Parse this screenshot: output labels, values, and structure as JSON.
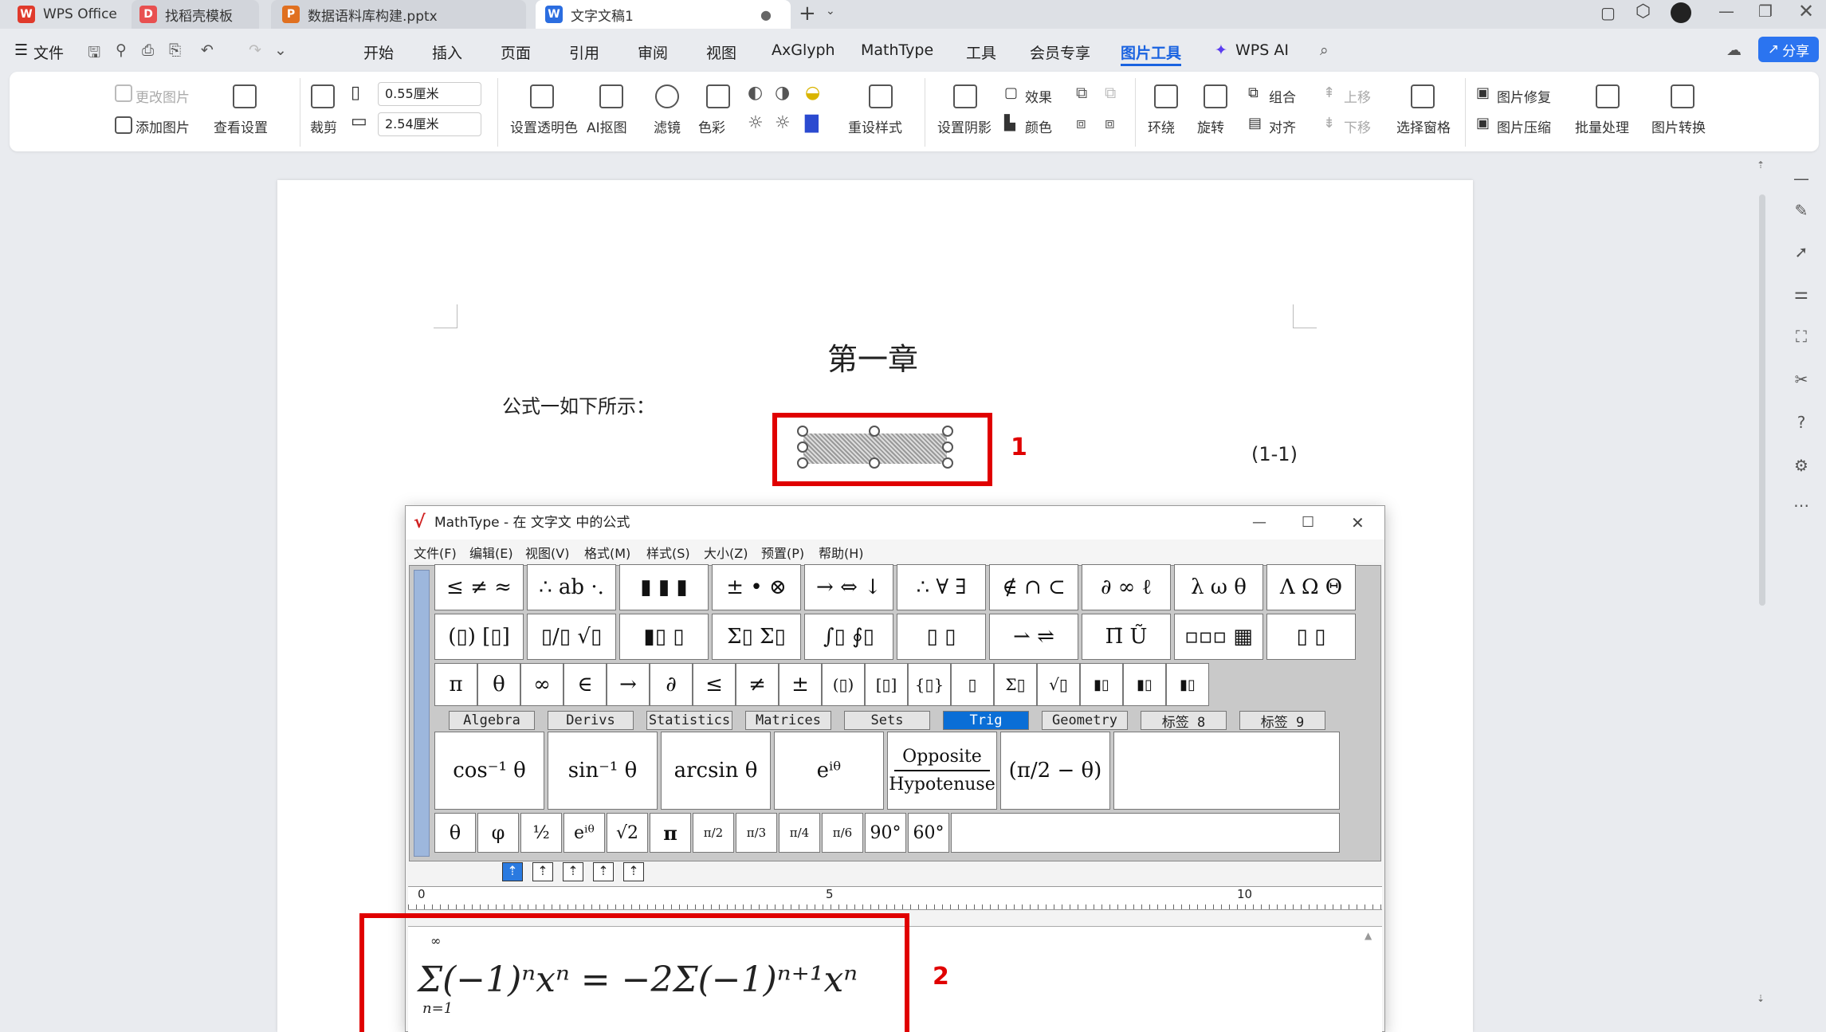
{
  "tabs": [
    {
      "label": "WPS Office",
      "color": "#e03a2c"
    },
    {
      "label": "找稻壳模板",
      "color": "#e85050"
    },
    {
      "label": "数据语料库构建.pptx",
      "color": "#e07020"
    },
    {
      "label": "文字文稿1",
      "color": "#2b6de0"
    }
  ],
  "file_menu": "文件",
  "menu_items": [
    "开始",
    "插入",
    "页面",
    "引用",
    "审阅",
    "视图",
    "AxGlyph",
    "MathType",
    "工具",
    "会员专享",
    "图片工具",
    "WPS AI"
  ],
  "share_label": "分享",
  "ribbon": {
    "change_image": "更改图片",
    "add_image": "添加图片",
    "view_settings": "查看设置",
    "crop": "裁剪",
    "width_val": "0.55厘米",
    "height_val": "2.54厘米",
    "transparent": "设置透明色",
    "ai_cutout": "AI抠图",
    "filter": "滤镜",
    "color_tone": "色彩",
    "reset_style": "重设样式",
    "shadow": "设置阴影",
    "effect": "效果",
    "fill_color": "颜色",
    "wrap": "环绕",
    "rotate": "旋转",
    "group": "组合",
    "align": "对齐",
    "move_up": "上移",
    "move_down": "下移",
    "select_pane": "选择窗格",
    "repair": "图片修复",
    "compress": "图片压缩",
    "batch": "批量处理",
    "convert": "图片转换"
  },
  "document": {
    "chapter": "第一章",
    "intro": "公式一如下所示：",
    "eq_number": "(1-1)"
  },
  "annotations": {
    "one": "1",
    "two": "2"
  },
  "mathtype": {
    "title": "MathType - 在 文字文 中的公式",
    "menu": [
      "文件(F)",
      "编辑(E)",
      "视图(V)",
      "格式(M)",
      "样式(S)",
      "大小(Z)",
      "预置(P)",
      "帮助(H)"
    ],
    "row1": [
      "≤ ≠ ≈",
      "∴ ab ·.",
      "▮ ▮ ▮",
      "± • ⊗",
      "→ ⇔ ↓",
      "∴ ∀ ∃",
      "∉ ∩ ⊂",
      "∂ ∞ ℓ",
      "λ ω θ",
      "Λ Ω Θ"
    ],
    "row2": [
      "(▯) [▯]",
      "▯/▯ √▯",
      "▮▯ ▯",
      "Σ▯ Σ▯",
      "∫▯ ∮▯",
      "▯ ▯",
      "⇀ ⇌",
      "Π̄ Ũ",
      "▫▫▫ ▦",
      "▯ ▯"
    ],
    "row3": [
      "π",
      "θ",
      "∞",
      "∈",
      "→",
      "∂",
      "≤",
      "≠",
      "±",
      "(▯)",
      "[▯]",
      "{▯}",
      "▯",
      "Σ▯",
      "√▯",
      "▮▯",
      "▮▯",
      "▮▯"
    ],
    "tabs": [
      "Algebra",
      "Derivs",
      "Statistics",
      "Matrices",
      "Sets",
      "Trig",
      "Geometry",
      "标签 8",
      "标签 9"
    ],
    "selected_tab": "Trig",
    "templates": [
      "cos⁻¹ θ",
      "sin⁻¹ θ",
      "arcsin θ",
      "eⁱᶿ",
      "Opposite",
      "Hypotenuse",
      "(π/2 − θ)"
    ],
    "small": [
      "θ",
      "φ",
      "½",
      "eⁱᶿ",
      "√2",
      "π",
      "π/2",
      "π/3",
      "π/4",
      "π/6",
      "90°",
      "60°"
    ],
    "ruler": [
      "0",
      "5",
      "10"
    ],
    "formula": "Σ(−1)ⁿxⁿ = −2Σ(−1)ⁿ⁺¹xⁿ",
    "formula_lower": "n=1",
    "formula_upper": "∞"
  }
}
